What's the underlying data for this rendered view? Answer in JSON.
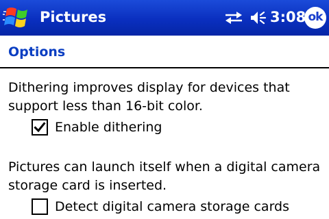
{
  "title_bar": {
    "start_icon": "windows-flag-icon",
    "app_title": "Pictures",
    "status_icons": [
      "connectivity-icon",
      "volume-icon"
    ],
    "time": "3:08",
    "ok_label": "ok"
  },
  "section": {
    "title": "Options"
  },
  "dithering": {
    "description": "Dithering improves display for devices that support less than 16-bit color.",
    "checkbox_label": "Enable dithering",
    "checked": true
  },
  "camera": {
    "description": "Pictures can launch itself when a digital camera storage card is inserted.",
    "checkbox_label": "Detect digital camera storage cards",
    "checked": false
  },
  "colors": {
    "title_bar_bg": "#0a2fbf",
    "title_text": "#ffffff",
    "section_title": "#0a3ec2",
    "body_text": "#000000",
    "divider": "#000000"
  }
}
